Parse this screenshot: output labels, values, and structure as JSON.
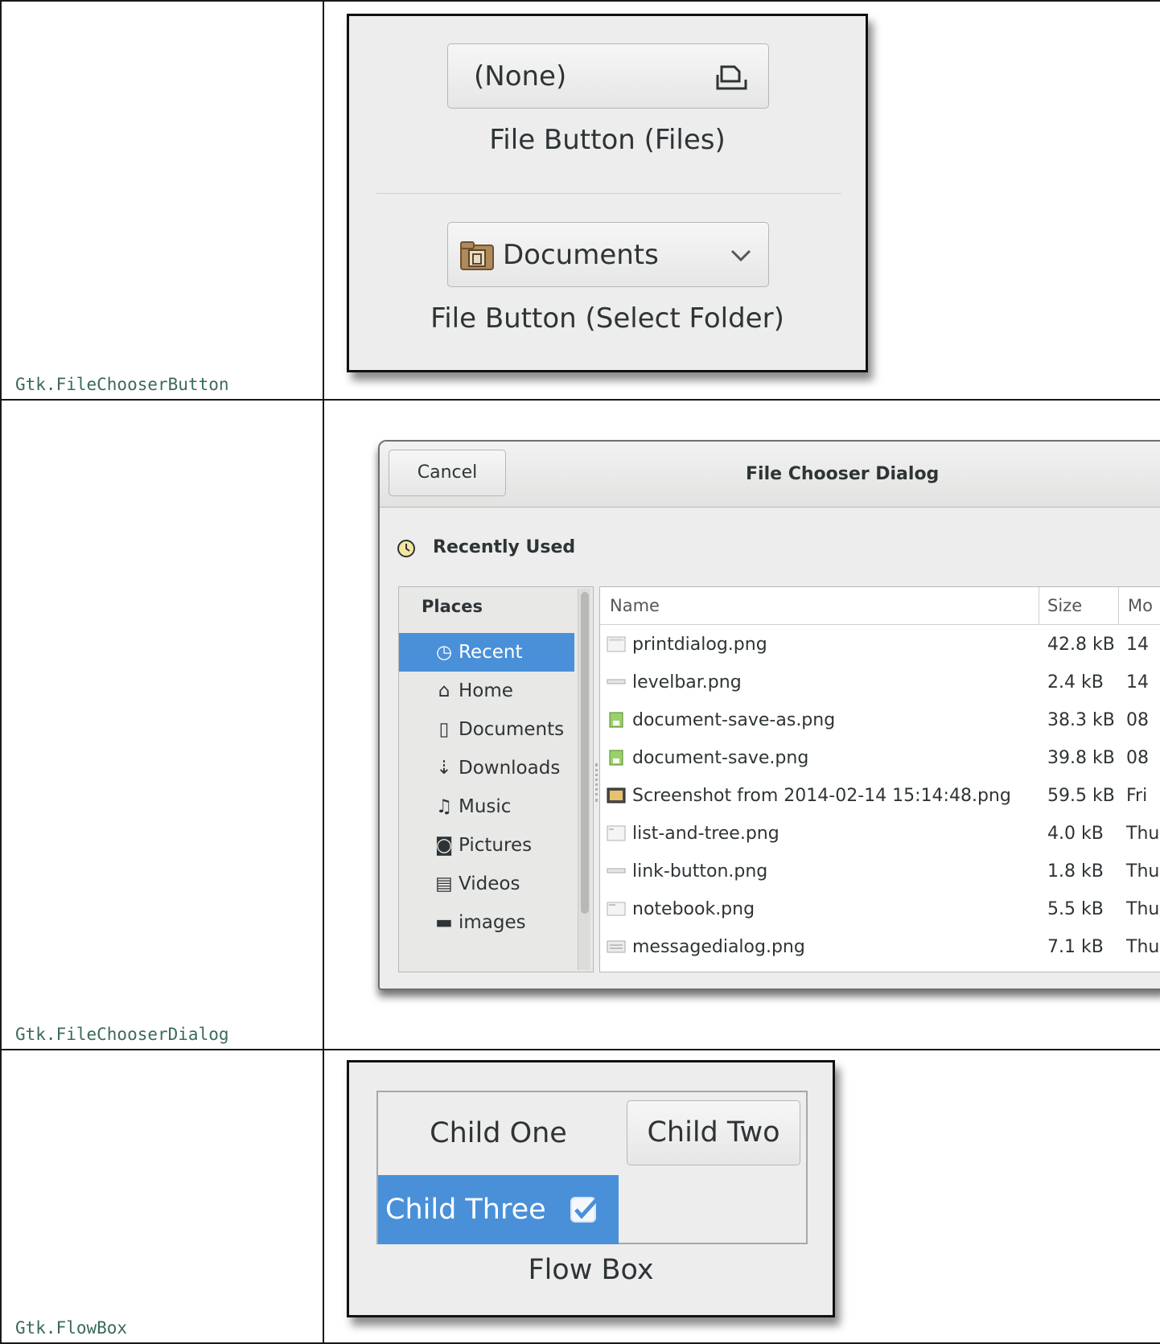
{
  "rows": [
    {
      "label": "Gtk.FileChooserButton"
    },
    {
      "label": "Gtk.FileChooserDialog"
    },
    {
      "label": "Gtk.FlowBox"
    }
  ],
  "file_button": {
    "files_value": "(None)",
    "files_icon": "open-document-icon",
    "files_caption": "File Button (Files)",
    "folder_value": "Documents",
    "folder_icon": "documents-folder-icon",
    "folder_caption": "File Button (Select Folder)"
  },
  "dialog": {
    "cancel_label": "Cancel",
    "title": "File Chooser Dialog",
    "location": "Recently Used",
    "places_header": "Places",
    "places": [
      {
        "label": "Recent",
        "icon": "clock-icon",
        "glyph": "◷",
        "selected": true
      },
      {
        "label": "Home",
        "icon": "home-icon",
        "glyph": "⌂",
        "selected": false
      },
      {
        "label": "Documents",
        "icon": "document-icon",
        "glyph": "▯",
        "selected": false
      },
      {
        "label": "Downloads",
        "icon": "download-icon",
        "glyph": "⇣",
        "selected": false
      },
      {
        "label": "Music",
        "icon": "music-icon",
        "glyph": "♫",
        "selected": false
      },
      {
        "label": "Pictures",
        "icon": "camera-icon",
        "glyph": "◙",
        "selected": false
      },
      {
        "label": "Videos",
        "icon": "film-icon",
        "glyph": "▤",
        "selected": false
      },
      {
        "label": "images",
        "icon": "folder-icon",
        "glyph": "▬",
        "selected": false
      }
    ],
    "columns": {
      "name": "Name",
      "size": "Size",
      "modified": "Mo"
    },
    "files": [
      {
        "name": "printdialog.png",
        "size": "42.8 kB",
        "modified": "14",
        "icon": "image-file-icon"
      },
      {
        "name": "levelbar.png",
        "size": "2.4 kB",
        "modified": "14",
        "icon": "image-file-icon"
      },
      {
        "name": "document-save-as.png",
        "size": "38.3 kB",
        "modified": "08",
        "icon": "image-file-icon"
      },
      {
        "name": "document-save.png",
        "size": "39.8 kB",
        "modified": "08",
        "icon": "image-file-icon"
      },
      {
        "name": "Screenshot from 2014-02-14 15:14:48.png",
        "size": "59.5 kB",
        "modified": "Fri",
        "icon": "image-file-icon"
      },
      {
        "name": "list-and-tree.png",
        "size": "4.0 kB",
        "modified": "Thu",
        "icon": "image-file-icon"
      },
      {
        "name": "link-button.png",
        "size": "1.8 kB",
        "modified": "Thu",
        "icon": "image-file-icon"
      },
      {
        "name": "notebook.png",
        "size": "5.5 kB",
        "modified": "Thu",
        "icon": "image-file-icon"
      },
      {
        "name": "messagedialog.png",
        "size": "7.1 kB",
        "modified": "Thu",
        "icon": "image-file-icon"
      }
    ]
  },
  "flowbox": {
    "child_one": "Child One",
    "child_two": "Child Two",
    "child_three": "Child Three",
    "caption": "Flow Box"
  },
  "colors": {
    "accent": "#4a90d9",
    "label": "#3b6a5a"
  }
}
